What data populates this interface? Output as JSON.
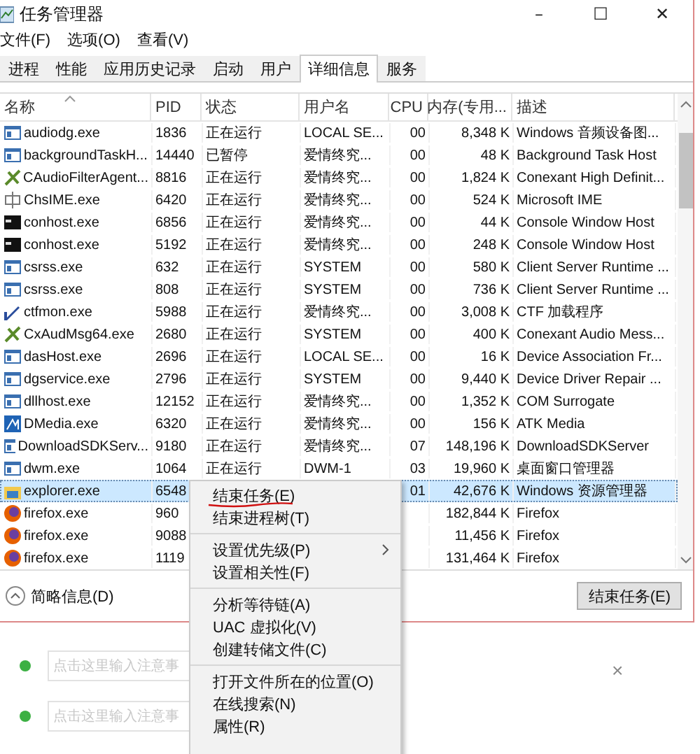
{
  "window": {
    "title": "任务管理器",
    "controls": [
      "–",
      "☐",
      "✕"
    ]
  },
  "menu": [
    "文件(F)",
    "选项(O)",
    "查看(V)"
  ],
  "tabs": [
    {
      "label": "进程",
      "selected": false
    },
    {
      "label": "性能",
      "selected": false
    },
    {
      "label": "应用历史记录",
      "selected": false
    },
    {
      "label": "启动",
      "selected": false
    },
    {
      "label": "用户",
      "selected": false
    },
    {
      "label": "详细信息",
      "selected": true
    },
    {
      "label": "服务",
      "selected": false
    }
  ],
  "table": {
    "columns": [
      "名称",
      "PID",
      "状态",
      "用户名",
      "CPU",
      "内存(专用...",
      "描述"
    ],
    "rows": [
      {
        "name": "audiodg.exe",
        "pid": "1836",
        "status": "正在运行",
        "user": "LOCAL SE...",
        "cpu": "00",
        "memory": "8,348 K",
        "description": "Windows 音频设备图...",
        "selected": false
      },
      {
        "name": "backgroundTaskH...",
        "pid": "14440",
        "status": "已暂停",
        "user": "爱情终究...",
        "cpu": "00",
        "memory": "48 K",
        "description": "Background Task Host",
        "selected": false
      },
      {
        "name": "CAudioFilterAgent...",
        "pid": "8816",
        "status": "正在运行",
        "user": "爱情终究...",
        "cpu": "00",
        "memory": "1,824 K",
        "description": "Conexant High Definit...",
        "selected": false
      },
      {
        "name": "ChsIME.exe",
        "pid": "6420",
        "status": "正在运行",
        "user": "爱情终究...",
        "cpu": "00",
        "memory": "524 K",
        "description": "Microsoft IME",
        "selected": false
      },
      {
        "name": "conhost.exe",
        "pid": "6856",
        "status": "正在运行",
        "user": "爱情终究...",
        "cpu": "00",
        "memory": "44 K",
        "description": "Console Window Host",
        "selected": false
      },
      {
        "name": "conhost.exe",
        "pid": "5192",
        "status": "正在运行",
        "user": "爱情终究...",
        "cpu": "00",
        "memory": "248 K",
        "description": "Console Window Host",
        "selected": false
      },
      {
        "name": "csrss.exe",
        "pid": "632",
        "status": "正在运行",
        "user": "SYSTEM",
        "cpu": "00",
        "memory": "580 K",
        "description": "Client Server Runtime ...",
        "selected": false
      },
      {
        "name": "csrss.exe",
        "pid": "808",
        "status": "正在运行",
        "user": "SYSTEM",
        "cpu": "00",
        "memory": "736 K",
        "description": "Client Server Runtime ...",
        "selected": false
      },
      {
        "name": "ctfmon.exe",
        "pid": "5988",
        "status": "正在运行",
        "user": "爱情终究...",
        "cpu": "00",
        "memory": "3,008 K",
        "description": "CTF 加载程序",
        "selected": false
      },
      {
        "name": "CxAudMsg64.exe",
        "pid": "2680",
        "status": "正在运行",
        "user": "SYSTEM",
        "cpu": "00",
        "memory": "400 K",
        "description": "Conexant Audio Mess...",
        "selected": false
      },
      {
        "name": "dasHost.exe",
        "pid": "2696",
        "status": "正在运行",
        "user": "LOCAL SE...",
        "cpu": "00",
        "memory": "16 K",
        "description": "Device Association Fr...",
        "selected": false
      },
      {
        "name": "dgservice.exe",
        "pid": "2796",
        "status": "正在运行",
        "user": "SYSTEM",
        "cpu": "00",
        "memory": "9,440 K",
        "description": "Device Driver Repair ...",
        "selected": false
      },
      {
        "name": "dllhost.exe",
        "pid": "12152",
        "status": "正在运行",
        "user": "爱情终究...",
        "cpu": "00",
        "memory": "1,352 K",
        "description": "COM Surrogate",
        "selected": false
      },
      {
        "name": "DMedia.exe",
        "pid": "6320",
        "status": "正在运行",
        "user": "爱情终究...",
        "cpu": "00",
        "memory": "156 K",
        "description": "ATK Media",
        "selected": false
      },
      {
        "name": "DownloadSDKServ...",
        "pid": "9180",
        "status": "正在运行",
        "user": "爱情终究...",
        "cpu": "07",
        "memory": "148,196 K",
        "description": "DownloadSDKServer",
        "selected": false
      },
      {
        "name": "dwm.exe",
        "pid": "1064",
        "status": "正在运行",
        "user": "DWM-1",
        "cpu": "03",
        "memory": "19,960 K",
        "description": "桌面窗口管理器",
        "selected": false
      },
      {
        "name": "explorer.exe",
        "pid": "6548",
        "cpu": "01",
        "memory": "42,676 K",
        "description": "Windows 资源管理器",
        "selected": true
      },
      {
        "name": "firefox.exe",
        "pid": "960",
        "memory": "182,844 K",
        "description": "Firefox",
        "selected": false
      },
      {
        "name": "firefox.exe",
        "pid": "9088",
        "memory": "11,456 K",
        "description": "Firefox",
        "selected": false
      },
      {
        "name": "firefox.exe",
        "pid": "1119",
        "memory": "131,464 K",
        "description": "Firefox",
        "selected": false
      }
    ]
  },
  "footer": {
    "details_toggle": "简略信息(D)",
    "end_task_button": "结束任务(E)"
  },
  "background_notes": [
    {
      "placeholder": "点击这里输入注意事",
      "color": "#3cb043"
    },
    {
      "placeholder": "点击这里输入注意事",
      "color": "#3cb043"
    }
  ],
  "background_close": "×",
  "context_menu": [
    {
      "label": "结束任务(E)",
      "submenu": false,
      "separator_after": false
    },
    {
      "label": "结束进程树(T)",
      "submenu": false,
      "separator_after": true
    },
    {
      "label": "设置优先级(P)",
      "submenu": true,
      "separator_after": false
    },
    {
      "label": "设置相关性(F)",
      "submenu": false,
      "separator_after": true
    },
    {
      "label": "分析等待链(A)",
      "submenu": false,
      "separator_after": false
    },
    {
      "label": "UAC 虚拟化(V)",
      "submenu": false,
      "separator_after": false
    },
    {
      "label": "创建转储文件(C)",
      "submenu": false,
      "separator_after": true
    },
    {
      "label": "打开文件所在的位置(O)",
      "submenu": false,
      "separator_after": false
    },
    {
      "label": "在线搜索(N)",
      "submenu": false,
      "separator_after": false
    },
    {
      "label": "属性(R)",
      "submenu": false,
      "separator_after": false
    }
  ]
}
